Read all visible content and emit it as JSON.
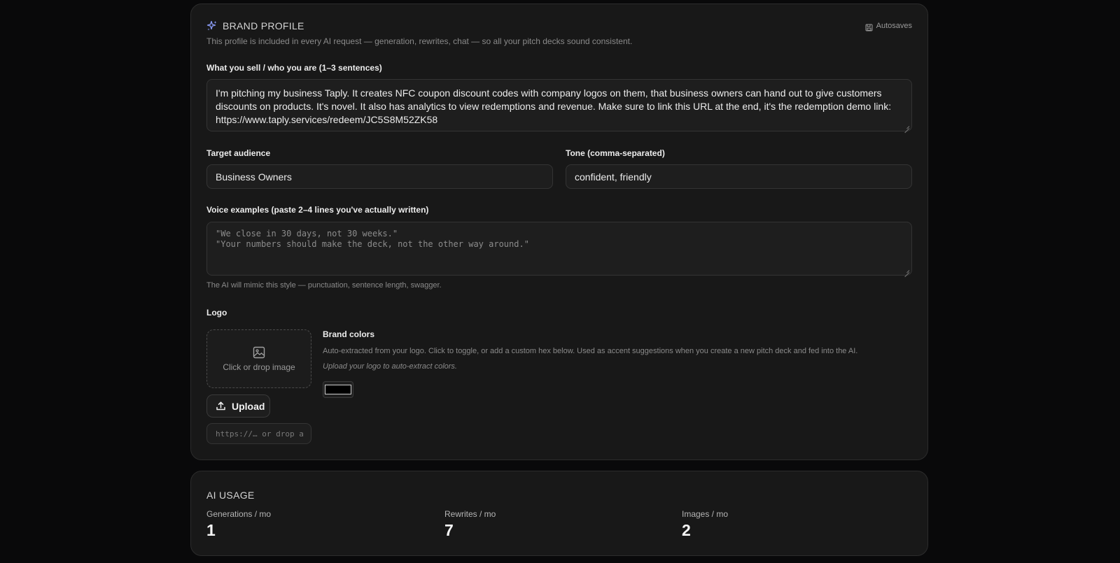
{
  "brand_profile": {
    "title": "BRAND PROFILE",
    "autosave_label": "Autosaves",
    "description": "This profile is included in every AI request — generation, rewrites, chat — so all your pitch decks sound consistent.",
    "what_you_sell": {
      "label": "What you sell / who you are (1–3 sentences)",
      "value": "I'm pitching my business Taply. It creates NFC coupon discount codes with company logos on them, that business owners can hand out to give customers discounts on products. It's novel. It also has analytics to view redemptions and revenue. Make sure to link this URL at the end, it's the redemption demo link:\nhttps://www.taply.services/redeem/JC5S8M52ZK58"
    },
    "target_audience": {
      "label": "Target audience",
      "value": "Business Owners"
    },
    "tone": {
      "label": "Tone (comma-separated)",
      "value": "confident, friendly"
    },
    "voice_examples": {
      "label": "Voice examples (paste 2–4 lines you've actually written)",
      "placeholder": "\"We close in 30 days, not 30 weeks.\"\n\"Your numbers should make the deck, not the other way around.\"",
      "help": "The AI will mimic this style — punctuation, sentence length, swagger."
    },
    "logo": {
      "label": "Logo",
      "dropzone_text": "Click or drop image",
      "upload_label": "Upload",
      "url_placeholder": "https://… or drop a"
    },
    "brand_colors": {
      "label": "Brand colors",
      "description": "Auto-extracted from your logo. Click to toggle, or add a custom hex below. Used as accent suggestions when you create a new pitch deck and fed into the AI.",
      "hint": "Upload your logo to auto-extract colors.",
      "swatch_color": "#000000"
    }
  },
  "ai_usage": {
    "title": "AI USAGE",
    "stats": [
      {
        "label": "Generations / mo",
        "value": "1"
      },
      {
        "label": "Rewrites / mo",
        "value": "7"
      },
      {
        "label": "Images / mo",
        "value": "2"
      }
    ]
  },
  "colors": {
    "background": "#09090a",
    "card": "#181818",
    "sparkle_accent": "#8b9cf7"
  },
  "icons": {
    "title": "sparkles-icon",
    "autosave": "save-icon",
    "dropzone": "image-icon",
    "upload": "upload-icon"
  }
}
